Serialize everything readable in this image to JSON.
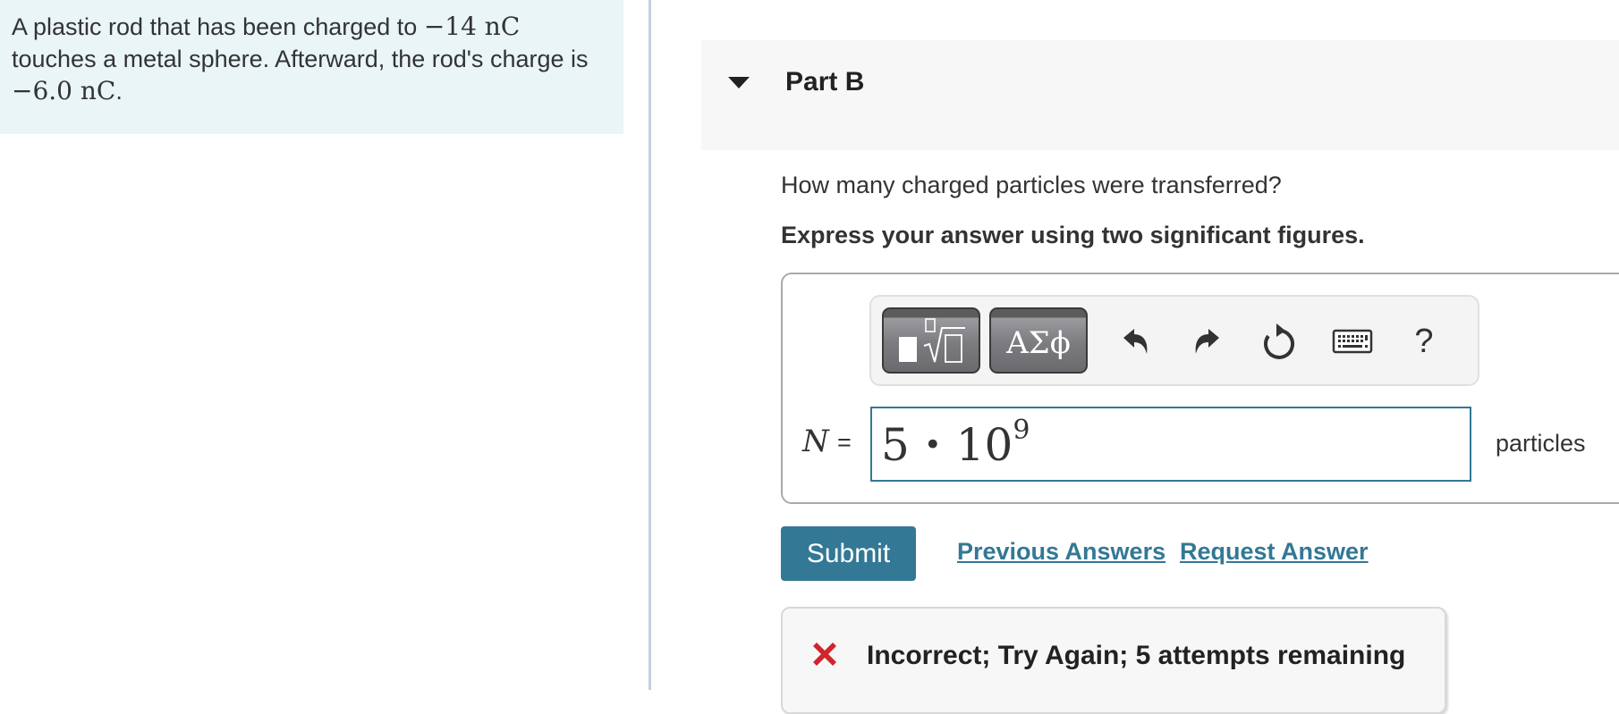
{
  "problem": {
    "text_part1": "A plastic rod that has been charged to ",
    "charge_initial": "−14 nC",
    "text_part2": " touches a metal sphere. Afterward, the rod's charge is ",
    "charge_final": "−6.0 nC",
    "text_part3": "."
  },
  "part": {
    "title": "Part B",
    "caret_icon": "caret-down-icon",
    "question": "How many charged particles were transferred?",
    "instructions": "Express your answer using two significant figures."
  },
  "toolbar": {
    "templates_icon": "templates-sqrt-icon",
    "symbols_label": "ΑΣϕ",
    "undo_icon": "undo-icon",
    "redo_icon": "redo-icon",
    "reset_icon": "reset-icon",
    "keyboard_icon": "keyboard-icon",
    "help_label": "?"
  },
  "answer": {
    "variable": "N",
    "equals": "=",
    "mantissa": "5",
    "operator": "•",
    "base": "10",
    "exponent": "9",
    "unit": "particles"
  },
  "actions": {
    "submit_label": "Submit",
    "previous_answers_label": "Previous Answers",
    "request_answer_label": "Request Answer"
  },
  "feedback": {
    "icon": "incorrect-x-icon",
    "message": "Incorrect; Try Again; 5 attempts remaining",
    "icon_color": "#d0262b"
  },
  "colors": {
    "accent": "#337895",
    "problem_bg": "#e9f5f7",
    "header_bg": "#f7f7f7"
  }
}
